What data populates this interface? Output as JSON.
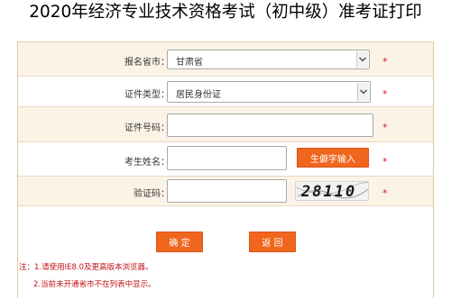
{
  "page": {
    "title": "2020年经济专业技术资格考试（初中级）准考证打印"
  },
  "form": {
    "province": {
      "label": "报名省市：",
      "value": "甘肃省",
      "required": "*"
    },
    "id_type": {
      "label": "证件类型：",
      "value": "居民身份证",
      "required": "*"
    },
    "id_number": {
      "label": "证件号码：",
      "value": "",
      "required": "*"
    },
    "name": {
      "label": "考生姓名：",
      "value": "",
      "rare_char_button": "生僻字输入",
      "required": "*"
    },
    "captcha": {
      "label": "验证码：",
      "value": "",
      "image_text": "28110",
      "required": "*"
    }
  },
  "actions": {
    "confirm": "确 定",
    "back": "返 回"
  },
  "notes": {
    "line1": "注：1.请使用IE8.0及更高版本浏览器。",
    "line2": "2.当前未开通省市不在列表中显示。"
  },
  "colors": {
    "accent": "#f0661e",
    "required": "#e0141a",
    "row_alt_bg": "#fcf3e7",
    "border": "#e0c7a8"
  }
}
